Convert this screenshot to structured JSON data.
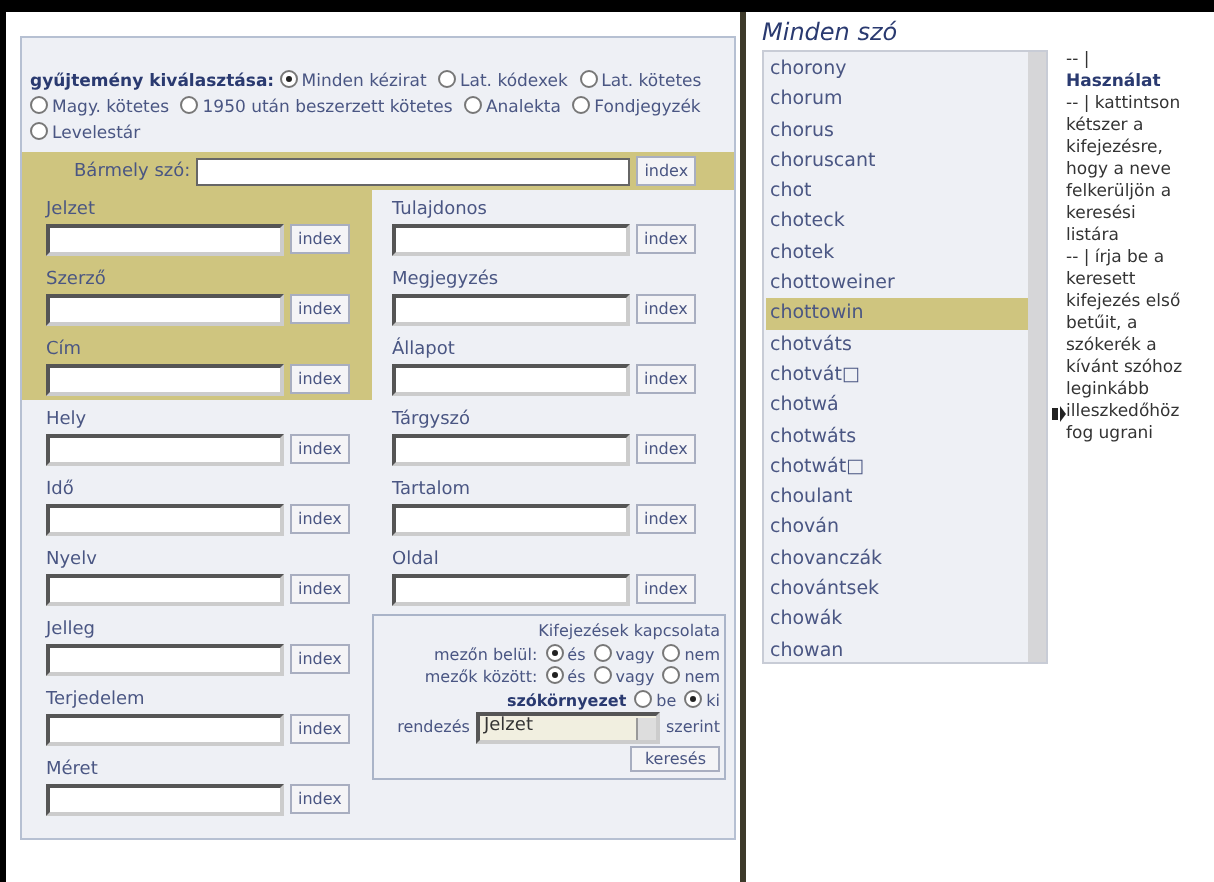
{
  "collection": {
    "label": "gyűjtemény kiválasztása:",
    "options": [
      {
        "label": "Minden kézirat",
        "selected": true
      },
      {
        "label": "Lat. kódexek",
        "selected": false
      },
      {
        "label": "Lat. kötetes",
        "selected": false
      },
      {
        "label": "Magy. kötetes",
        "selected": false
      },
      {
        "label": "1950 után beszerzett kötetes",
        "selected": false
      },
      {
        "label": "Analekta",
        "selected": false
      },
      {
        "label": "Fondjegyzék",
        "selected": false
      },
      {
        "label": "Levelestár",
        "selected": false
      }
    ]
  },
  "any_word": {
    "label": "Bármely szó:",
    "button": "index"
  },
  "left_fields": [
    {
      "label": "Jelzet",
      "button": "index",
      "highlighted": true
    },
    {
      "label": "Szerző",
      "button": "index",
      "highlighted": true
    },
    {
      "label": "Cím",
      "button": "index",
      "highlighted": true
    },
    {
      "label": "Hely",
      "button": "index",
      "highlighted": false
    },
    {
      "label": "Idő",
      "button": "index",
      "highlighted": false
    },
    {
      "label": "Nyelv",
      "button": "index",
      "highlighted": false
    },
    {
      "label": "Jelleg",
      "button": "index",
      "highlighted": false
    },
    {
      "label": "Terjedelem",
      "button": "index",
      "highlighted": false
    },
    {
      "label": "Méret",
      "button": "index",
      "highlighted": false
    }
  ],
  "right_fields": [
    {
      "label": "Tulajdonos",
      "button": "index"
    },
    {
      "label": "Megjegyzés",
      "button": "index"
    },
    {
      "label": "Állapot",
      "button": "index"
    },
    {
      "label": "Tárgyszó",
      "button": "index"
    },
    {
      "label": "Tartalom",
      "button": "index"
    },
    {
      "label": "Oldal",
      "button": "index"
    }
  ],
  "relations": {
    "title": "Kifejezések kapcsolata",
    "rows": [
      {
        "label": "mezőn belül:",
        "options": [
          {
            "label": "és",
            "selected": true
          },
          {
            "label": "vagy",
            "selected": false
          },
          {
            "label": "nem",
            "selected": false
          }
        ]
      },
      {
        "label": "mezők között:",
        "options": [
          {
            "label": "és",
            "selected": true
          },
          {
            "label": "vagy",
            "selected": false
          },
          {
            "label": "nem",
            "selected": false
          }
        ]
      }
    ],
    "context": {
      "label": "szókörnyezet",
      "options": [
        {
          "label": "be",
          "selected": false
        },
        {
          "label": "ki",
          "selected": true
        }
      ]
    },
    "sort": {
      "label": "rendezés",
      "value": "Jelzet",
      "suffix": "szerint"
    },
    "search_button": "keresés"
  },
  "word_list": {
    "title": "Minden szó",
    "items": [
      {
        "label": "chorony",
        "selected": false
      },
      {
        "label": "chorum",
        "selected": false
      },
      {
        "label": "chorus",
        "selected": false
      },
      {
        "label": "choruscant",
        "selected": false
      },
      {
        "label": "chot",
        "selected": false
      },
      {
        "label": "choteck",
        "selected": false
      },
      {
        "label": "chotek",
        "selected": false
      },
      {
        "label": "chottoweiner",
        "selected": false
      },
      {
        "label": "chottowin",
        "selected": true
      },
      {
        "label": "chotváts",
        "selected": false
      },
      {
        "label": "chotvát□",
        "selected": false
      },
      {
        "label": "chotwá",
        "selected": false
      },
      {
        "label": "chotwáts",
        "selected": false
      },
      {
        "label": "chotwát□",
        "selected": false
      },
      {
        "label": "choulant",
        "selected": false
      },
      {
        "label": "chován",
        "selected": false
      },
      {
        "label": "chovanczák",
        "selected": false
      },
      {
        "label": "chovántsek",
        "selected": false
      },
      {
        "label": "chowák",
        "selected": false
      },
      {
        "label": "chowan",
        "selected": false
      }
    ]
  },
  "help": [
    "-- | **Használat**",
    "-- | kattintson kétszer a kifejezésre, hogy a neve felkerüljön a keresési listára",
    "-- | írja be a keresett kifejezés első betűit, a szókerék a kívánt szóhoz leginkább illeszkedőhöz fog ugrani"
  ]
}
